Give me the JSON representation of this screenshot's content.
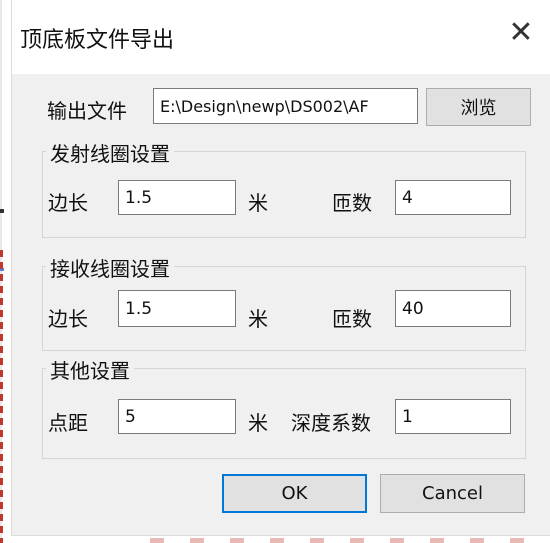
{
  "window": {
    "title": "顶底板文件导出",
    "close_glyph": "✕"
  },
  "output": {
    "label": "输出文件",
    "path": "E:\\Design\\newp\\DS002\\AF",
    "browse_label": "浏览"
  },
  "transmit": {
    "legend": "发射线圈设置",
    "side_label": "边长",
    "side_value": "1.5",
    "side_unit": "米",
    "turns_label": "匝数",
    "turns_value": "4"
  },
  "receive": {
    "legend": "接收线圈设置",
    "side_label": "边长",
    "side_value": "1.5",
    "side_unit": "米",
    "turns_label": "匝数",
    "turns_value": "40"
  },
  "other": {
    "legend": "其他设置",
    "spacing_label": "点距",
    "spacing_value": "5",
    "spacing_unit": "米",
    "depth_label": "深度系数",
    "depth_value": "1"
  },
  "actions": {
    "ok_label": "OK",
    "cancel_label": "Cancel"
  },
  "colors": {
    "default_button_border": "#0078d7",
    "dialog_client": "#f0f0f0"
  }
}
